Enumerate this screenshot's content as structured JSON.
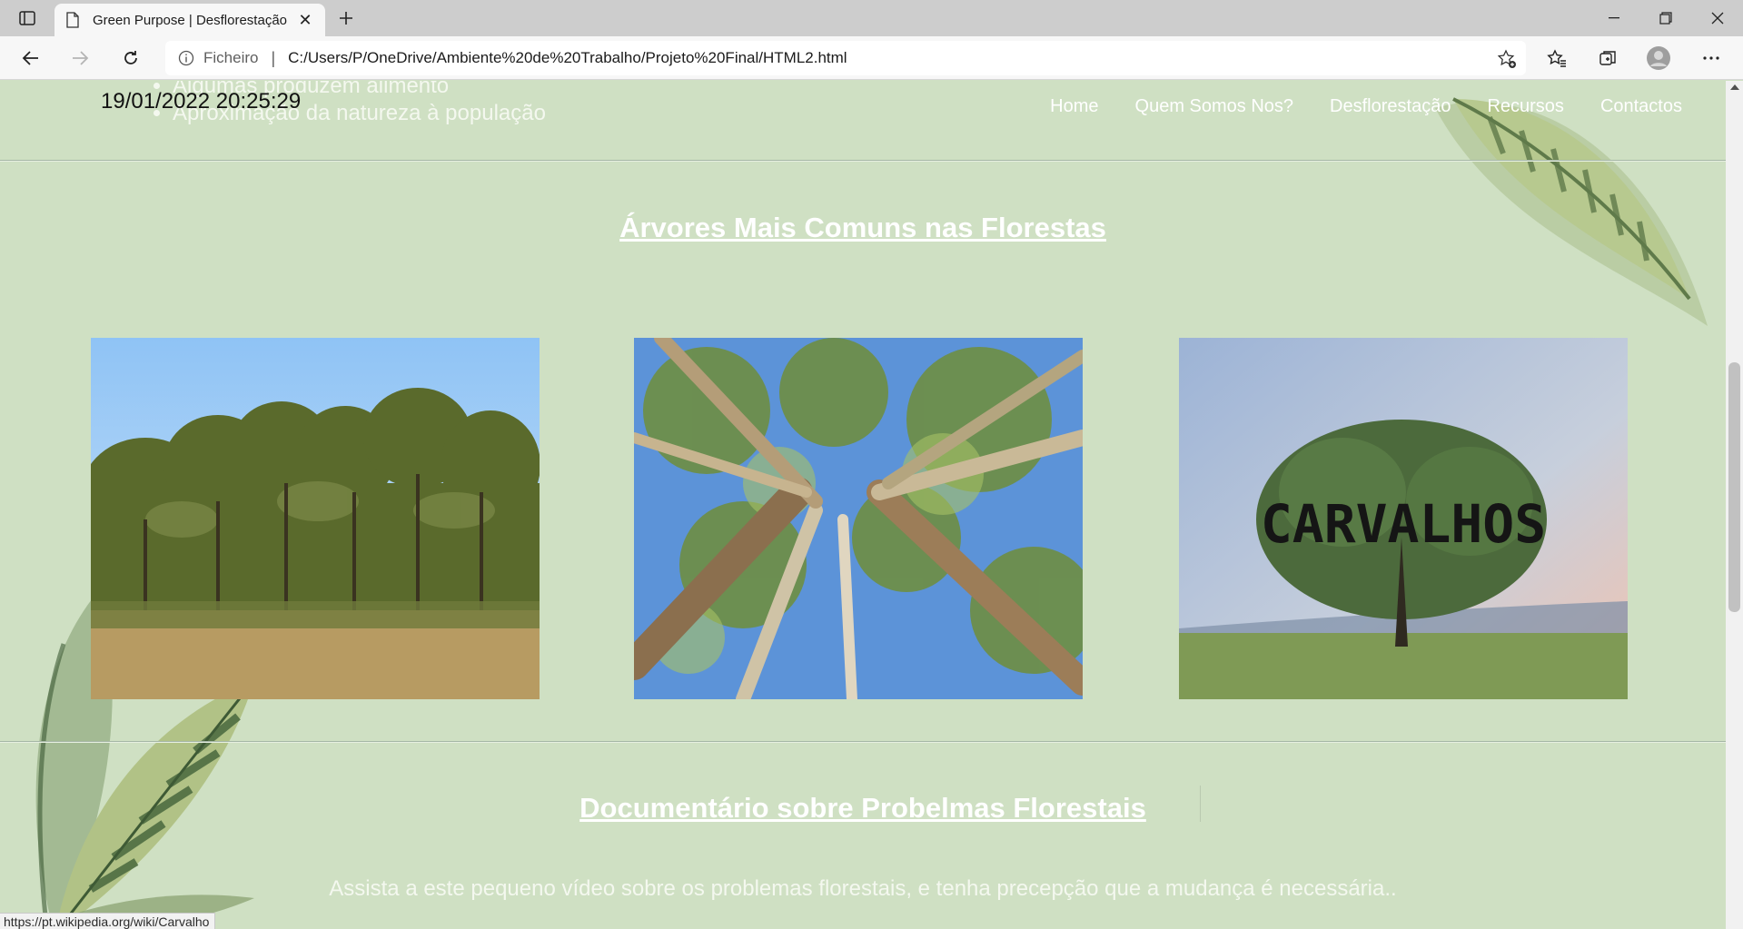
{
  "browser": {
    "tab_title": "Green Purpose | Desflorestação",
    "address_scheme": "Ficheiro",
    "address_separator": "|",
    "url": "C:/Users/P/OneDrive/Ambiente%20de%20Trabalho/Projeto%20Final/HTML2.html",
    "status_link": "https://pt.wikipedia.org/wiki/Carvalho"
  },
  "header": {
    "bullets": [
      "Algumas produzem alimento",
      "Aproximação da natureza à população"
    ],
    "datetime": "19/01/2022 20:25:29",
    "nav": [
      "Home",
      "Quem Somos Nos?",
      "Desflorestação",
      "Recursos",
      "Contactos"
    ]
  },
  "trees_section": {
    "title": "Árvores Mais Comuns nas Florestas",
    "photos": [
      {
        "name": "araucaria-photo"
      },
      {
        "name": "eucalipto-photo"
      },
      {
        "name": "carvalho-photo",
        "overlay_text": "CARVALHOS"
      }
    ]
  },
  "doc_section": {
    "title": "Documentário sobre Probelmas Florestais",
    "text": "Assista a este pequeno vídeo sobre os problemas florestais, e tenha precepção que a mudança é necessária.."
  },
  "colors": {
    "page_bg": "#cfe0c3",
    "text_light": "#ffffff",
    "leaf_dark": "#4e6b3e",
    "leaf_light": "#b8c98c"
  },
  "icons": [
    "tab-actions-icon",
    "document-icon",
    "close-icon",
    "plus-icon",
    "minimize-icon",
    "restore-icon",
    "close-window-icon",
    "back-icon",
    "forward-icon",
    "refresh-icon",
    "info-icon",
    "add-favorite-icon",
    "favorites-icon",
    "collections-icon",
    "profile-icon",
    "more-icon"
  ]
}
